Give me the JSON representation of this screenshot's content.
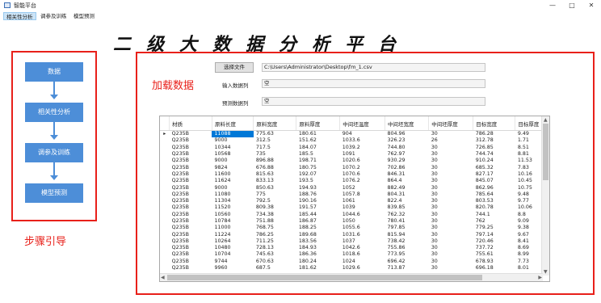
{
  "window": {
    "title": "智能平台",
    "minimize": "—",
    "maximize": "□",
    "close": "✕"
  },
  "menu": [
    "相关性分析",
    "调参及训练",
    "模型预测"
  ],
  "main_title": "二级大数据分析平台",
  "steps": {
    "label": "步骤引导",
    "items": [
      "数据",
      "相关性分析",
      "调参及训练",
      "模型预测"
    ]
  },
  "data_panel": {
    "label": "加载数据",
    "select_button": "选择文件",
    "file_path": "C:\\Users\\Administrator\\Desktop\\fm_1.csv",
    "input_label": "输入数据列",
    "input_value": "空",
    "predict_label": "预测数据列",
    "predict_value": "空"
  },
  "table": {
    "columns": [
      "材质",
      "原料长度",
      "原料宽度",
      "原料厚度",
      "中间坯温度",
      "中间坯宽度",
      "中间坯厚度",
      "目标宽度",
      "目标厚度"
    ],
    "rows": [
      [
        "Q235B",
        "11088",
        "775.63",
        "180.61",
        "904",
        "804.96",
        "30",
        "786.28",
        "9.49"
      ],
      [
        "Q235B",
        "9000",
        "312.5",
        "151.62",
        "1033.6",
        "326.23",
        "26",
        "312.78",
        "1.71"
      ],
      [
        "Q235B",
        "10344",
        "717.5",
        "184.07",
        "1039.2",
        "744.80",
        "30",
        "726.85",
        "8.51"
      ],
      [
        "Q235B",
        "10568",
        "735",
        "185.5",
        "1091",
        "762.97",
        "30",
        "744.74",
        "8.81"
      ],
      [
        "Q235B",
        "9000",
        "896.88",
        "198.71",
        "1020.6",
        "930.29",
        "30",
        "910.24",
        "11.53"
      ],
      [
        "Q235B",
        "9824",
        "676.88",
        "180.75",
        "1070.2",
        "702.86",
        "30",
        "685.32",
        "7.83"
      ],
      [
        "Q235B",
        "11600",
        "815.63",
        "192.07",
        "1070.6",
        "846.31",
        "30",
        "827.17",
        "10.16"
      ],
      [
        "Q235B",
        "11624",
        "833.13",
        "193.5",
        "1076.2",
        "864.4",
        "30",
        "845.07",
        "10.45"
      ],
      [
        "Q235B",
        "9000",
        "850.63",
        "194.93",
        "1052",
        "882.49",
        "30",
        "862.96",
        "10.75"
      ],
      [
        "Q235B",
        "11080",
        "775",
        "188.76",
        "1057.8",
        "804.31",
        "30",
        "785.64",
        "9.48"
      ],
      [
        "Q235B",
        "11304",
        "792.5",
        "190.16",
        "1061",
        "822.4",
        "30",
        "803.53",
        "9.77"
      ],
      [
        "Q235B",
        "11520",
        "809.38",
        "191.57",
        "1039",
        "839.85",
        "30",
        "820.78",
        "10.06"
      ],
      [
        "Q235B",
        "10560",
        "734.38",
        "185.44",
        "1044.6",
        "762.32",
        "30",
        "744.1",
        "8.8"
      ],
      [
        "Q235B",
        "10784",
        "751.88",
        "186.87",
        "1050",
        "780.41",
        "30",
        "762",
        "9.09"
      ],
      [
        "Q235B",
        "11000",
        "768.75",
        "188.25",
        "1055.6",
        "797.85",
        "30",
        "779.25",
        "9.38"
      ],
      [
        "Q235B",
        "11224",
        "786.25",
        "189.68",
        "1031.6",
        "815.94",
        "30",
        "797.14",
        "9.67"
      ],
      [
        "Q235B",
        "10264",
        "711.25",
        "183.56",
        "1037",
        "738.42",
        "30",
        "720.46",
        "8.41"
      ],
      [
        "Q235B",
        "10480",
        "728.13",
        "184.93",
        "1042.6",
        "755.86",
        "30",
        "737.72",
        "8.69"
      ],
      [
        "Q235B",
        "10704",
        "745.63",
        "186.36",
        "1018.6",
        "773.95",
        "30",
        "755.61",
        "8.99"
      ],
      [
        "Q235B",
        "9744",
        "670.63",
        "180.24",
        "1024",
        "696.42",
        "30",
        "678.93",
        "7.73"
      ],
      [
        "Q235B",
        "9960",
        "687.5",
        "181.62",
        "1029.6",
        "713.87",
        "30",
        "696.18",
        "8.01"
      ]
    ]
  },
  "colors": {
    "accent_red": "#e8201a",
    "step_blue": "#4d8ed8",
    "selection_blue": "#0078d7"
  }
}
